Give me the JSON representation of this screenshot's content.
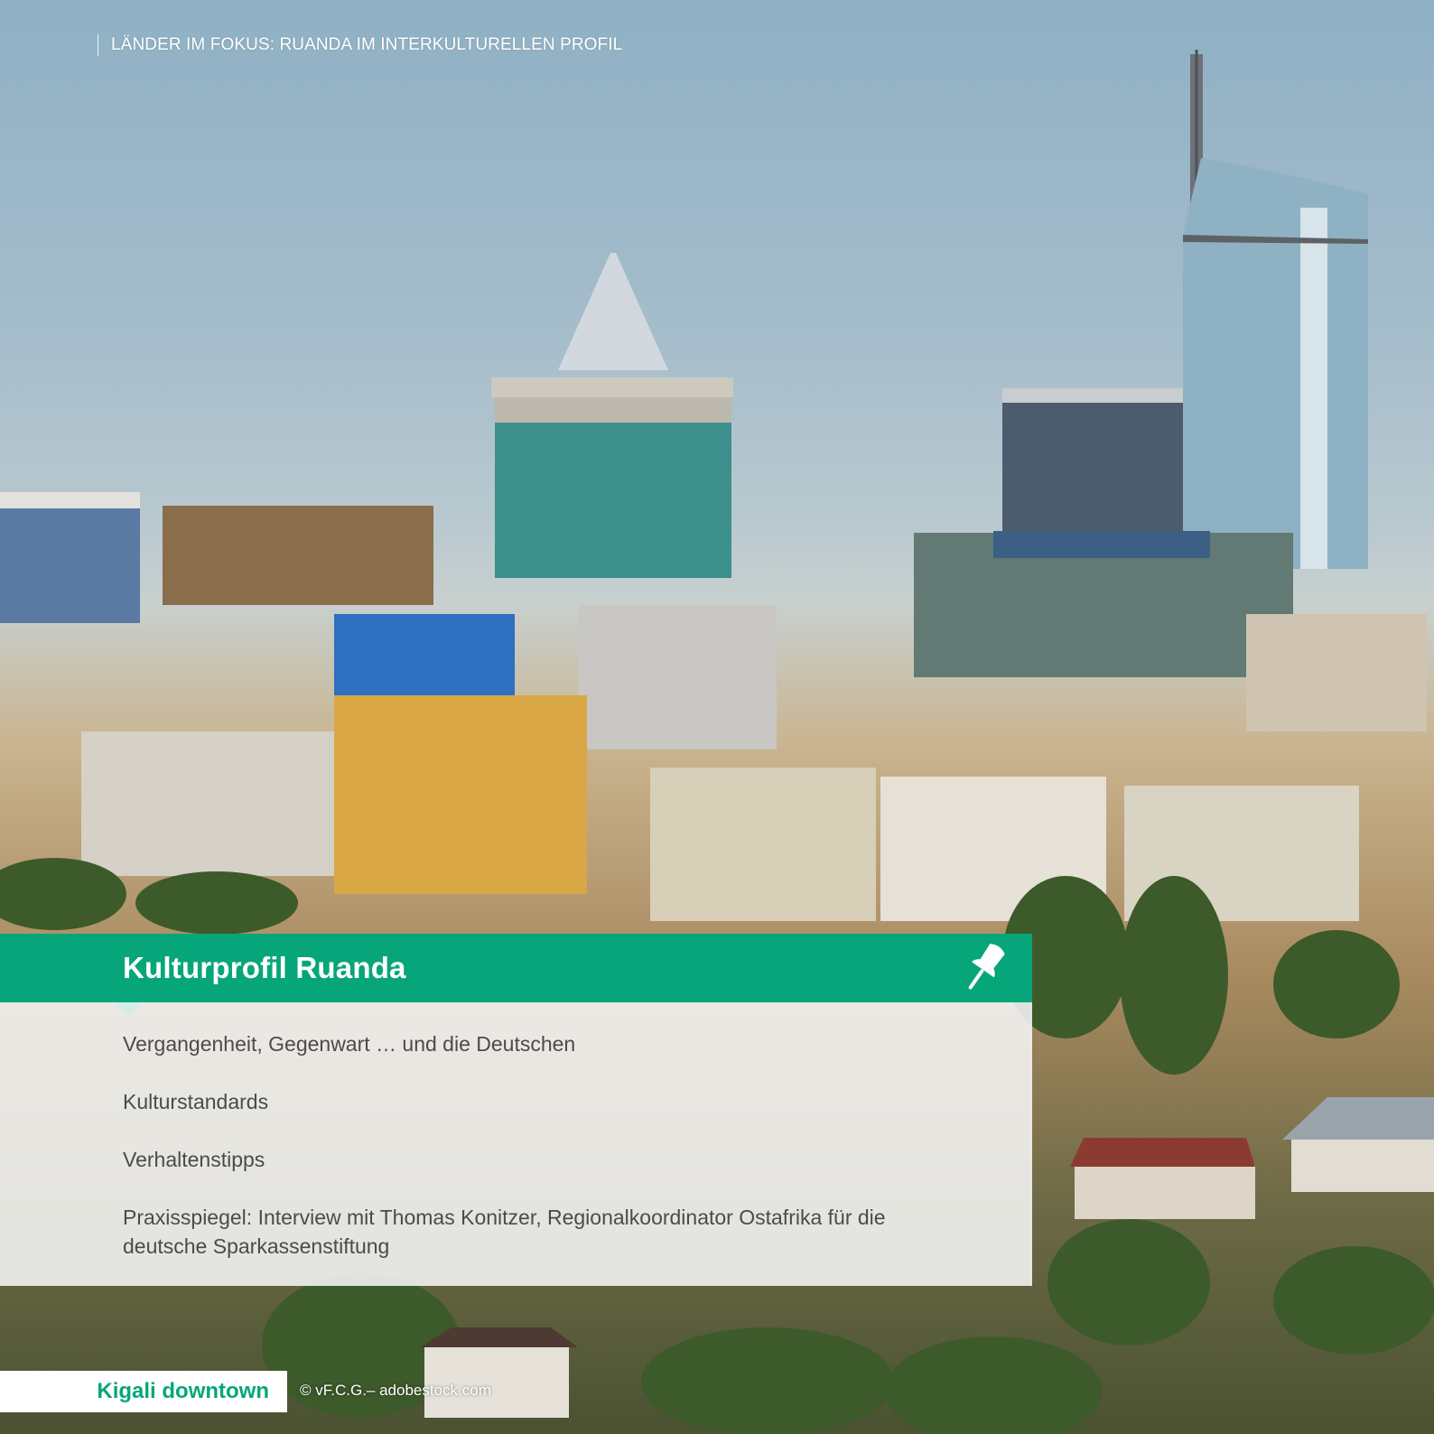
{
  "header": {
    "running_title": "LÄNDER IM FOKUS: RUANDA IM INTERKULTURELLEN PROFIL"
  },
  "content_box": {
    "title": "Kulturprofil Ruanda",
    "icon": "pin-icon",
    "items": [
      {
        "label": "Vergangenheit, Gegenwart … und die Deutschen"
      },
      {
        "label": "Kulturstandards"
      },
      {
        "label": "Verhaltenstipps"
      },
      {
        "label": "Praxisspiegel: Interview mit Thomas Konitzer, Regionalkoordinator Ostafrika für die deutsche Sparkassenstiftung"
      }
    ]
  },
  "caption": {
    "label": "Kigali downtown",
    "credit": "© vF.C.G.– adobestock.com"
  },
  "colors": {
    "accent_green": "#07a67a",
    "body_text": "#4b4b4b",
    "panel_background": "#f6f6f6"
  }
}
